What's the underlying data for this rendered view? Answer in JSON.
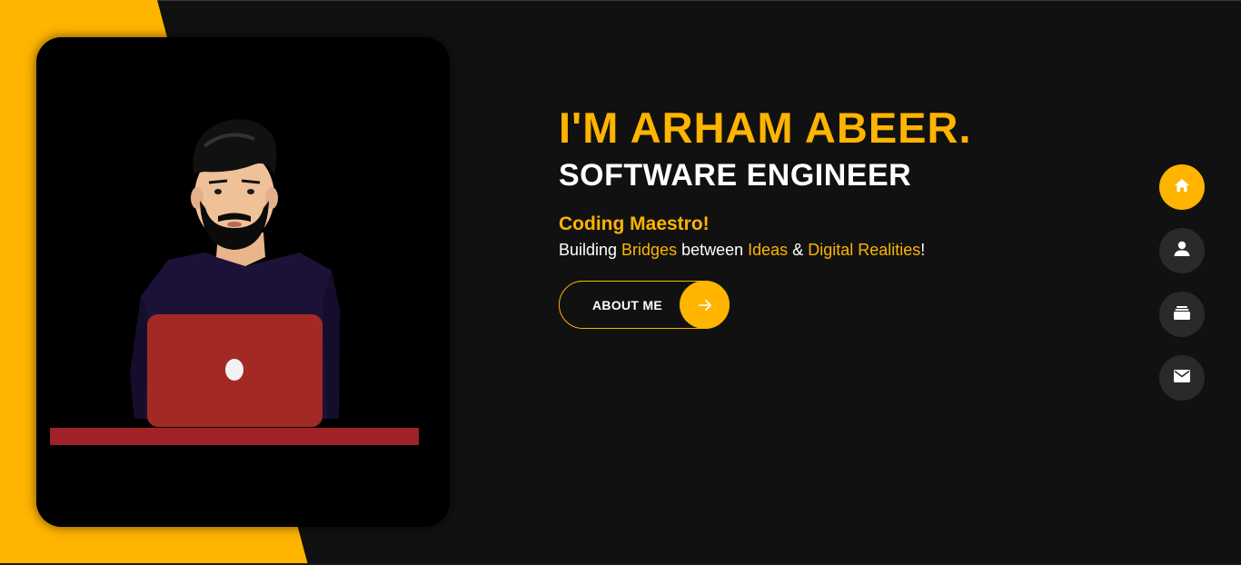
{
  "colors": {
    "accent": "#ffb400",
    "background": "#111111",
    "nav_idle": "#2b2a2a"
  },
  "hero": {
    "title": "I'M ARHAM ABEER.",
    "subtitle": "SOFTWARE ENGINEER",
    "tagline": "Coding Maestro!",
    "subline": {
      "part1": "Building ",
      "hl1": "Bridges",
      "part2": " between ",
      "hl2": "Ideas",
      "part3": " & ",
      "hl3": "Digital Realities",
      "part4": "!"
    }
  },
  "about_button": {
    "label": "ABOUT ME",
    "icon": "arrow-right-icon"
  },
  "side_nav": [
    {
      "icon": "home-icon",
      "active": true
    },
    {
      "icon": "user-icon",
      "active": false
    },
    {
      "icon": "briefcase-icon",
      "active": false
    },
    {
      "icon": "mail-icon",
      "active": false
    }
  ]
}
